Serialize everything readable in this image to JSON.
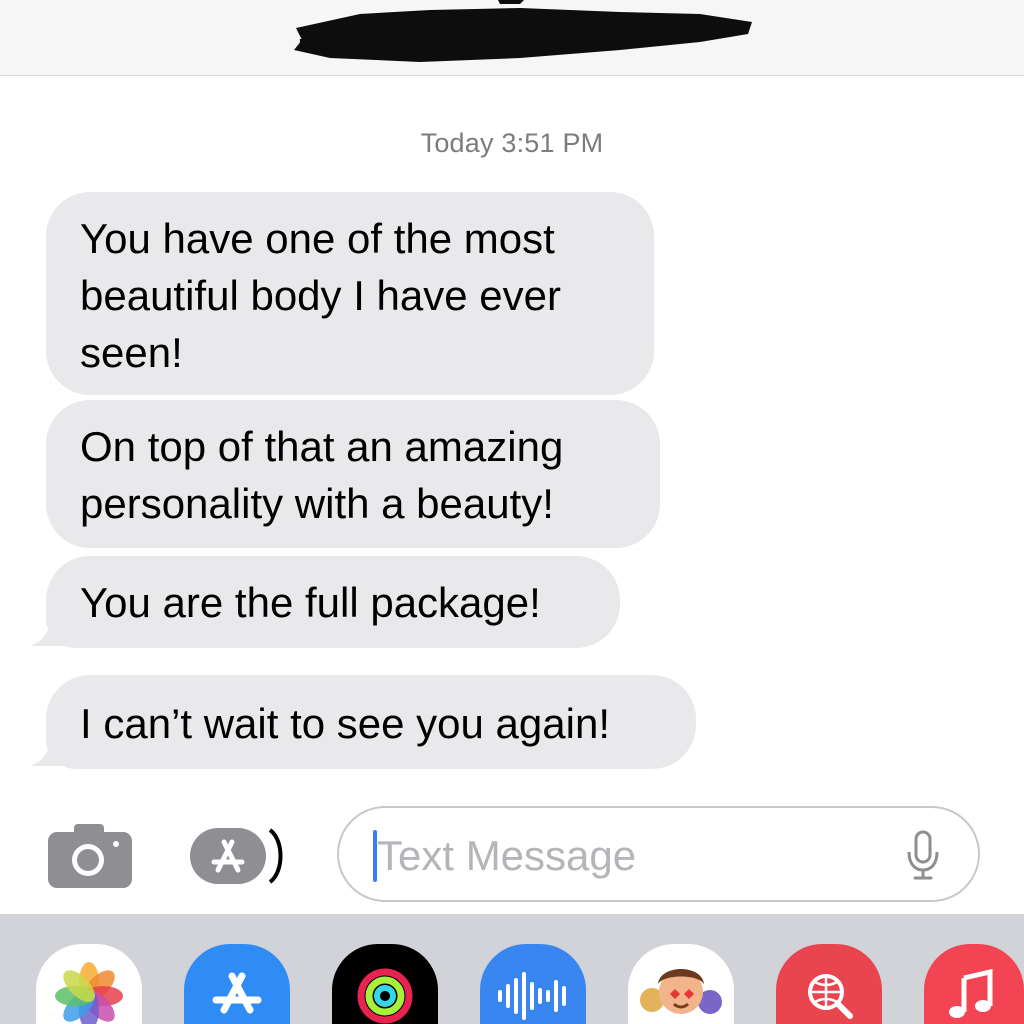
{
  "conversation": {
    "timestamp": "Today 3:51 PM",
    "messages": [
      {
        "lines": [
          "You have one of the most",
          "beautiful body I have ever",
          "seen!"
        ]
      },
      {
        "lines": [
          "On top of that an amazing",
          "personality with a beauty!"
        ]
      },
      {
        "lines": [
          "You are the full package!"
        ]
      },
      {
        "lines": [
          "I can’t wait to see you again!"
        ]
      }
    ]
  },
  "compose": {
    "placeholder": "Text Message",
    "camera_icon": "camera-icon",
    "apps_icon": "app-store-icon",
    "mic_icon": "microphone-icon"
  },
  "app_drawer": {
    "apps": [
      "photos-icon",
      "app-store-icon",
      "activity-icon",
      "audio-message-icon",
      "memoji-icon",
      "web-image-search-icon",
      "music-icon"
    ]
  },
  "colors": {
    "incoming_bubble": "#e9e9eb",
    "cursor": "#3b7cf6",
    "drawer_background": "#d1d3d9"
  }
}
